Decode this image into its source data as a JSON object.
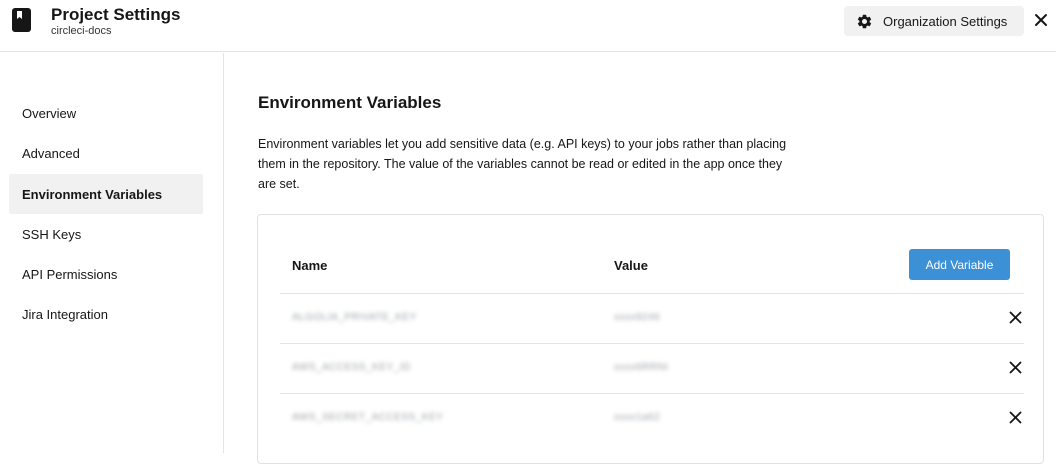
{
  "header": {
    "title": "Project Settings",
    "project": "circleci-docs",
    "org_settings_label": "Organization Settings"
  },
  "sidebar": {
    "items": [
      {
        "label": "Overview"
      },
      {
        "label": "Advanced"
      },
      {
        "label": "Environment Variables",
        "active": true
      },
      {
        "label": "SSH Keys"
      },
      {
        "label": "API Permissions"
      },
      {
        "label": "Jira Integration"
      }
    ]
  },
  "main": {
    "title": "Environment Variables",
    "description": "Environment variables let you add sensitive data (e.g. API keys) to your jobs rather than placing them in the repository. The value of the variables cannot be read or edited in the app once they are set.",
    "table": {
      "columns": [
        "Name",
        "Value"
      ],
      "add_button_label": "Add Variable",
      "rows": [
        {
          "name": "ALGOLIA_PRIVATE_KEY",
          "value": "xxxx9246"
        },
        {
          "name": "AWS_ACCESS_KEY_ID",
          "value": "xxxx6RRNI"
        },
        {
          "name": "AWS_SECRET_ACCESS_KEY",
          "value": "xxxx1a62"
        }
      ]
    }
  },
  "colors": {
    "accent": "#3b90d6",
    "active_bg": "#f1f1f1",
    "border": "#e4e4e4"
  },
  "icons": {
    "logo": "circleci-book-icon",
    "org": "gear-icon",
    "close": "close-icon",
    "delete": "close-icon"
  }
}
